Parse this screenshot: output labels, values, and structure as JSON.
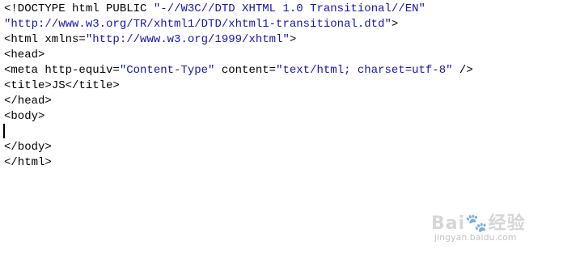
{
  "editor": {
    "lines": [
      [
        {
          "t": "<!DOCTYPE html PUBLIC ",
          "c": "tag"
        },
        {
          "t": "\"-//W3C//DTD XHTML 1.0 Transitional//EN\"",
          "c": "str"
        }
      ],
      [
        {
          "t": "\"http://www.w3.org/TR/xhtml1/DTD/xhtml1-transitional.dtd\"",
          "c": "str"
        },
        {
          "t": ">",
          "c": "tag"
        }
      ],
      [
        {
          "t": "<html xmlns=",
          "c": "tag"
        },
        {
          "t": "\"http://www.w3.org/1999/xhtml\"",
          "c": "str"
        },
        {
          "t": ">",
          "c": "tag"
        }
      ],
      [
        {
          "t": "<head>",
          "c": "tag"
        }
      ],
      [
        {
          "t": "<meta http-equiv=",
          "c": "tag"
        },
        {
          "t": "\"Content-Type\"",
          "c": "str"
        },
        {
          "t": " content=",
          "c": "tag"
        },
        {
          "t": "\"text/html; charset=utf-8\"",
          "c": "str"
        },
        {
          "t": " />",
          "c": "tag"
        }
      ],
      [
        {
          "t": "<title>",
          "c": "tag"
        },
        {
          "t": "JS",
          "c": "tag"
        },
        {
          "t": "</title>",
          "c": "tag"
        }
      ],
      [
        {
          "t": "</head>",
          "c": "tag"
        }
      ],
      [
        {
          "t": "<body>",
          "c": "tag"
        }
      ],
      [],
      [
        {
          "t": "</body>",
          "c": "tag"
        }
      ],
      [
        {
          "t": "</html>",
          "c": "tag"
        }
      ]
    ]
  },
  "watermark": {
    "logo_left": "Bai",
    "logo_paw": "🐾",
    "logo_right": "经验",
    "url": "jingyan.baidu.com"
  }
}
